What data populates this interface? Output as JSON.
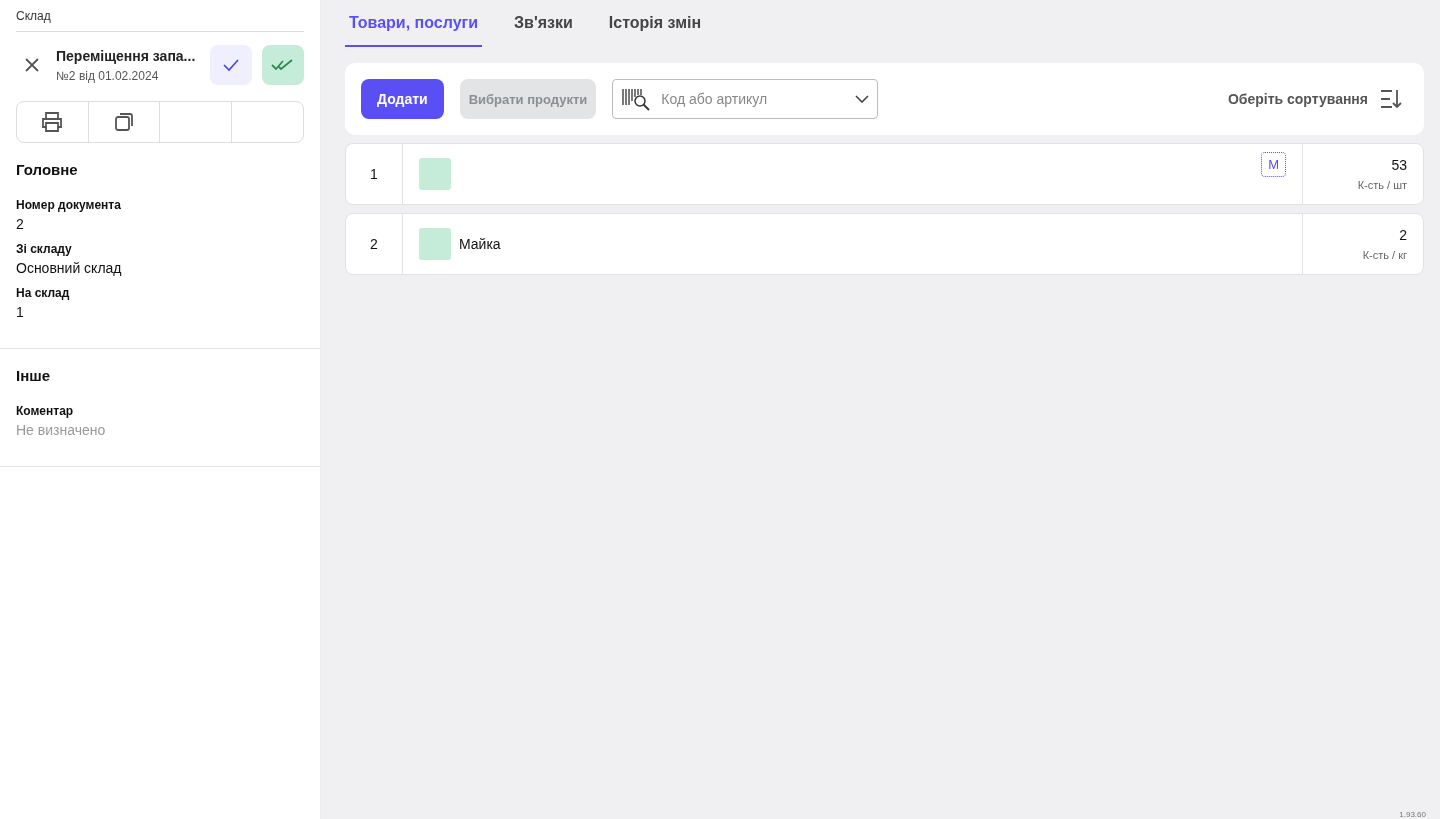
{
  "breadcrumb": "Склад",
  "document": {
    "title": "Переміщення запа...",
    "subtitle": "№2 від 01.02.2024"
  },
  "sidebar_sections": [
    {
      "title": "Головне",
      "fields": [
        {
          "label": "Номер документа",
          "value": "2",
          "empty": false
        },
        {
          "label": "Зі складу",
          "value": "Основний склад",
          "empty": false
        },
        {
          "label": "На склад",
          "value": "1",
          "empty": false
        }
      ]
    },
    {
      "title": "Інше",
      "fields": [
        {
          "label": "Коментар",
          "value": "Не визначено",
          "empty": true
        }
      ]
    }
  ],
  "tabs": [
    {
      "label": "Товари, послуги",
      "selected": true
    },
    {
      "label": "Зв'язки",
      "selected": false
    },
    {
      "label": "Історія змін",
      "selected": false
    }
  ],
  "toolbar": {
    "add_button": "Додати",
    "select_button": "Вибрати продукти",
    "search": {
      "placeholder": "Код або артикул"
    },
    "sort": "Оберіть сортування"
  },
  "rows": [
    {
      "index": "1",
      "badge": "M",
      "quantity": "53",
      "unit": "К-сть / шт"
    },
    {
      "index": "2",
      "name": "Майка",
      "quantity": "2",
      "unit": "К-сть / кг"
    }
  ],
  "version": "1.93.60"
}
